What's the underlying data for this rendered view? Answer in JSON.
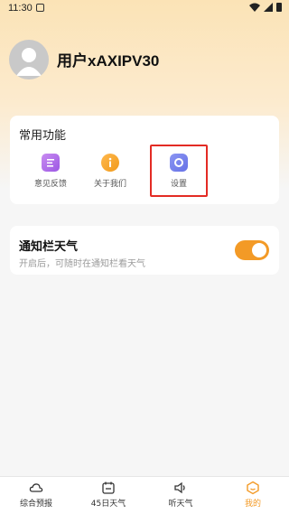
{
  "status_bar": {
    "time": "11:30"
  },
  "profile": {
    "username": "用户xAXIPV30"
  },
  "common_functions": {
    "title": "常用功能",
    "items": [
      {
        "label": "意见反馈",
        "icon": "feedback-icon"
      },
      {
        "label": "关于我们",
        "icon": "info-icon"
      },
      {
        "label": "设置",
        "icon": "settings-icon"
      }
    ]
  },
  "notification_weather": {
    "title": "通知栏天气",
    "subtitle": "开启后，可随时在通知栏看天气",
    "enabled": true,
    "accent": "#f39a26"
  },
  "bottom_nav": {
    "items": [
      {
        "label": "综合预报",
        "icon": "cloud-icon"
      },
      {
        "label": "45日天气",
        "icon": "calendar-icon"
      },
      {
        "label": "听天气",
        "icon": "speaker-icon"
      },
      {
        "label": "我的",
        "icon": "hexagon-profile-icon",
        "active": true
      }
    ]
  }
}
